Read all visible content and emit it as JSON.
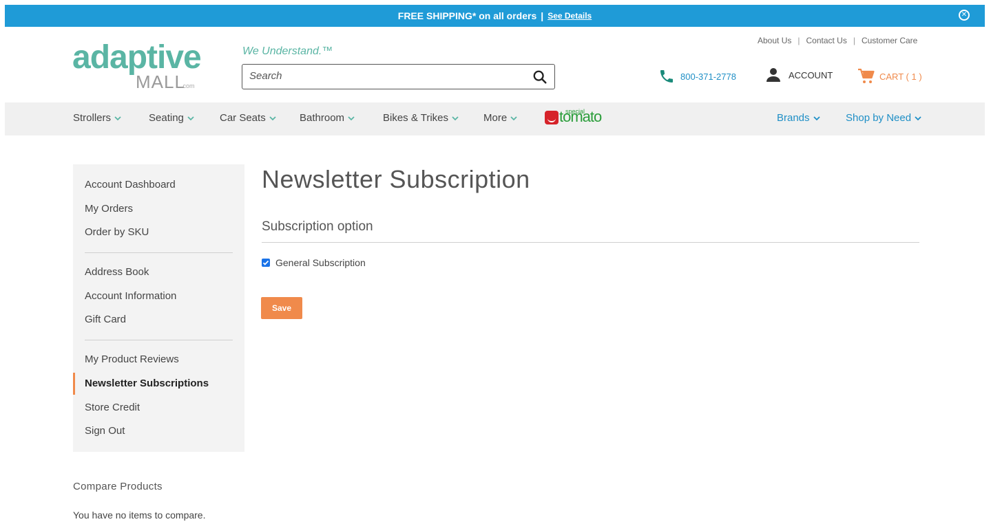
{
  "promo": {
    "text": "FREE SHIPPING* on all orders",
    "separator": "|",
    "link": "See Details",
    "close_glyph": "✕"
  },
  "logo": {
    "word1": "adaptive",
    "word2": "MALL",
    "word3": ".com"
  },
  "header": {
    "tagline": "We Understand.™",
    "search_placeholder": "Search",
    "top_links": [
      "About Us",
      "Contact Us",
      "Customer Care"
    ],
    "phone": "800-371-2778",
    "account": "ACCOUNT",
    "cart": "CART ( 1 )"
  },
  "nav": {
    "items": [
      "Strollers",
      "Seating",
      "Car Seats",
      "Bathroom",
      "Bikes & Trikes",
      "More"
    ],
    "brand_logo": {
      "word": "tomato",
      "small": "special"
    },
    "right_items": [
      "Brands",
      "Shop by Need"
    ]
  },
  "sidebar": {
    "group1": [
      "Account Dashboard",
      "My Orders",
      "Order by SKU"
    ],
    "group2": [
      "Address Book",
      "Account Information",
      "Gift Card"
    ],
    "group3": [
      "My Product Reviews",
      "Newsletter Subscriptions",
      "Store Credit",
      "Sign Out"
    ],
    "active": "Newsletter Subscriptions"
  },
  "main": {
    "title": "Newsletter Subscription",
    "section_title": "Subscription option",
    "checkbox_label": "General Subscription",
    "checkbox_checked": true,
    "save_label": "Save"
  },
  "compare": {
    "title": "Compare Products",
    "empty_text": "You have no items to compare."
  },
  "colors": {
    "promo_bar": "#1f9bd7",
    "brand_teal": "#5ab5a4",
    "accent_orange": "#f08a4b",
    "link_blue": "#1f8fc6"
  },
  "icons": [
    "close-circle-icon",
    "search-icon",
    "phone-icon",
    "user-icon",
    "cart-icon",
    "chevron-down-icon",
    "checkmark-icon"
  ]
}
